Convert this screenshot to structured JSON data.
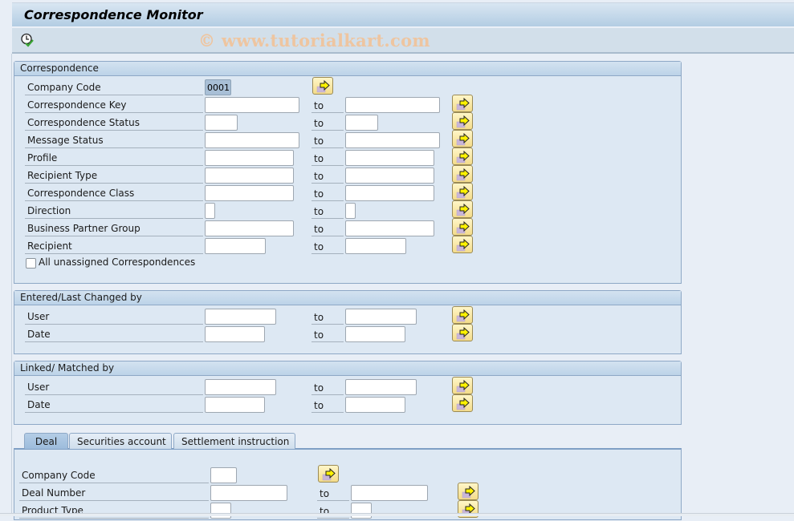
{
  "window": {
    "title": "Correspondence Monitor",
    "watermark": "© www.tutorialkart.com"
  },
  "toolbar": {
    "execute_icon": "execute-clock-check-icon"
  },
  "groups": {
    "correspondence": {
      "header": "Correspondence",
      "to_label": "to",
      "rows": [
        {
          "label": "Company Code",
          "low": "0001",
          "high": null
        },
        {
          "label": "Correspondence Key",
          "low": "",
          "high": ""
        },
        {
          "label": "Correspondence Status",
          "low": "",
          "high": ""
        },
        {
          "label": "Message Status",
          "low": "",
          "high": ""
        },
        {
          "label": "Profile",
          "low": "",
          "high": ""
        },
        {
          "label": "Recipient Type",
          "low": "",
          "high": ""
        },
        {
          "label": "Correspondence Class",
          "low": "",
          "high": ""
        },
        {
          "label": "Direction",
          "low": "",
          "high": ""
        },
        {
          "label": "Business Partner Group",
          "low": "",
          "high": ""
        },
        {
          "label": "Recipient",
          "low": "",
          "high": ""
        }
      ],
      "checkbox": {
        "label": "All unassigned Correspondences",
        "checked": false
      }
    },
    "entered": {
      "header": "Entered/Last Changed by",
      "rows": [
        {
          "label": "User",
          "low": "",
          "high": ""
        },
        {
          "label": "Date",
          "low": "",
          "high": ""
        }
      ]
    },
    "linked": {
      "header": "Linked/ Matched by",
      "rows": [
        {
          "label": "User",
          "low": "",
          "high": ""
        },
        {
          "label": "Date",
          "low": "",
          "high": ""
        }
      ]
    }
  },
  "tabs": {
    "items": [
      {
        "label": "Deal",
        "active": true
      },
      {
        "label": "Securities account",
        "active": false
      },
      {
        "label": "Settlement instruction",
        "active": false
      }
    ],
    "deal": {
      "rows": [
        {
          "label": "Company Code",
          "low": "",
          "high": null
        },
        {
          "label": "Deal Number",
          "low": "",
          "high": ""
        },
        {
          "label": "Product Type",
          "low": "",
          "high": ""
        }
      ]
    }
  },
  "icons": {
    "multiple_selection": "multiple-selection-arrow-icon"
  }
}
